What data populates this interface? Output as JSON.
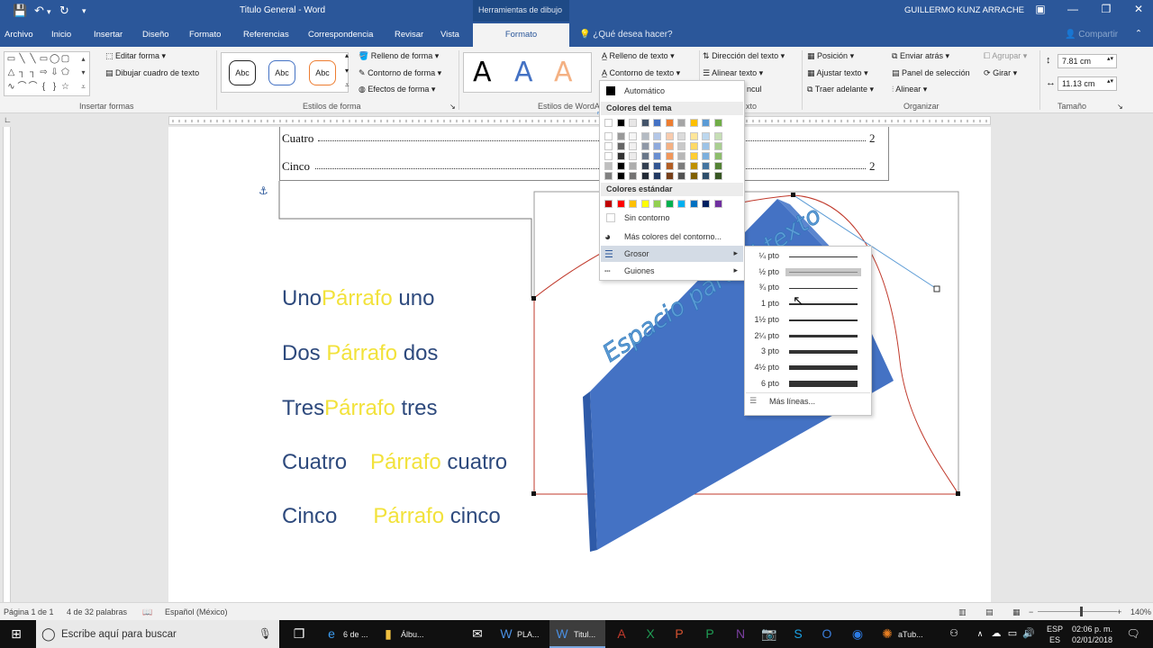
{
  "titlebar": {
    "title": "Titulo General  -  Word",
    "context_tab": "Herramientas de dibujo",
    "user": "GUILLERMO KUNZ ARRACHE"
  },
  "tabs": [
    "Archivo",
    "Inicio",
    "Insertar",
    "Diseño",
    "Formato",
    "Referencias",
    "Correspondencia",
    "Revisar",
    "Vista"
  ],
  "active_tab": "Formato",
  "tellme": "¿Qué desea hacer?",
  "share": "Compartir",
  "ribbon": {
    "insert_shapes": {
      "label": "Insertar formas",
      "edit_shape": "Editar forma",
      "draw_textbox": "Dibujar cuadro de texto"
    },
    "shape_styles": {
      "label": "Estilos de forma",
      "abc": "Abc",
      "fill": "Relleno de forma",
      "outline": "Contorno de forma",
      "effects": "Efectos de forma"
    },
    "wordart": {
      "label": "Estilos de WordArt",
      "letter": "A",
      "text_fill": "Relleno de texto",
      "text_outline": "Contorno de texto",
      "text_effects_partial": "ncul",
      "text_label_partial": "xto"
    },
    "text": {
      "direction": "Dirección del texto",
      "align": "Alinear texto"
    },
    "arrange": {
      "label": "Organizar",
      "position": "Posición",
      "wrap": "Ajustar texto",
      "forward": "Traer adelante",
      "backward": "Enviar atrás",
      "selection_pane": "Panel de selección",
      "align": "Alinear",
      "group": "Agrupar",
      "rotate": "Girar"
    },
    "size": {
      "label": "Tamaño",
      "height": "7.81 cm",
      "width": "11.13 cm"
    }
  },
  "document": {
    "toc": [
      {
        "label": "Cuatro",
        "page": "2"
      },
      {
        "label": "Cinco",
        "page": "2"
      }
    ],
    "paragraphs": [
      {
        "word": "Uno",
        "yellow": "Párrafo",
        "rest": "uno"
      },
      {
        "word": "Dos",
        "yellow": "Párrafo",
        "rest": "dos"
      },
      {
        "word": "Tres",
        "yellow": "Párrafo",
        "rest": "tres"
      },
      {
        "word": "Cuatro",
        "yellow": "Párrafo",
        "rest": "cuatro"
      },
      {
        "word": "Cinco",
        "yellow": "Párrafo",
        "rest": "cinco"
      }
    ],
    "wordart_text": "Espacio para el texto"
  },
  "outline_menu": {
    "automatic": "Automático",
    "theme_colors": "Colores del tema",
    "standard_colors": "Colores estándar",
    "no_outline": "Sin contorno",
    "more_colors": "Más colores del contorno...",
    "weight": "Grosor",
    "dashes": "Guiones",
    "theme_palette": [
      "#ffffff",
      "#000000",
      "#e7e6e6",
      "#44546a",
      "#4472c4",
      "#ed7d31",
      "#a5a5a5",
      "#ffc000",
      "#5b9bd5",
      "#70ad47"
    ],
    "standard_palette": [
      "#c00000",
      "#ff0000",
      "#ffc000",
      "#ffff00",
      "#92d050",
      "#00b050",
      "#00b0f0",
      "#0070c0",
      "#002060",
      "#7030a0"
    ]
  },
  "weight_menu": {
    "items": [
      {
        "label": "¼ pto",
        "thickness": 1
      },
      {
        "label": "½ pto",
        "thickness": 1
      },
      {
        "label": "¾ pto",
        "thickness": 1
      },
      {
        "label": "1 pto",
        "thickness": 1.5
      },
      {
        "label": "1½ pto",
        "thickness": 2
      },
      {
        "label": "2¼ pto",
        "thickness": 3
      },
      {
        "label": "3 pto",
        "thickness": 4
      },
      {
        "label": "4½ pto",
        "thickness": 5
      },
      {
        "label": "6 pto",
        "thickness": 7
      }
    ],
    "more_lines": "Más líneas..."
  },
  "status": {
    "page": "Página 1 de 1",
    "words": "4 de 32 palabras",
    "language": "Español (México)",
    "zoom": "140%"
  },
  "taskbar": {
    "search": "Escribe aquí para buscar",
    "apps": [
      "6 de ...",
      "Álbu...",
      "PLA...",
      "Titul...",
      "aTub..."
    ],
    "lang": "ESP",
    "lang2": "ES",
    "time": "02:06 p. m.",
    "date": "02/01/2018"
  },
  "colors": {
    "word_blue": "#2b579a",
    "shape_blue": "#4472c4",
    "text_navy": "#2e4a7d",
    "text_yellow": "#f2e23b"
  }
}
